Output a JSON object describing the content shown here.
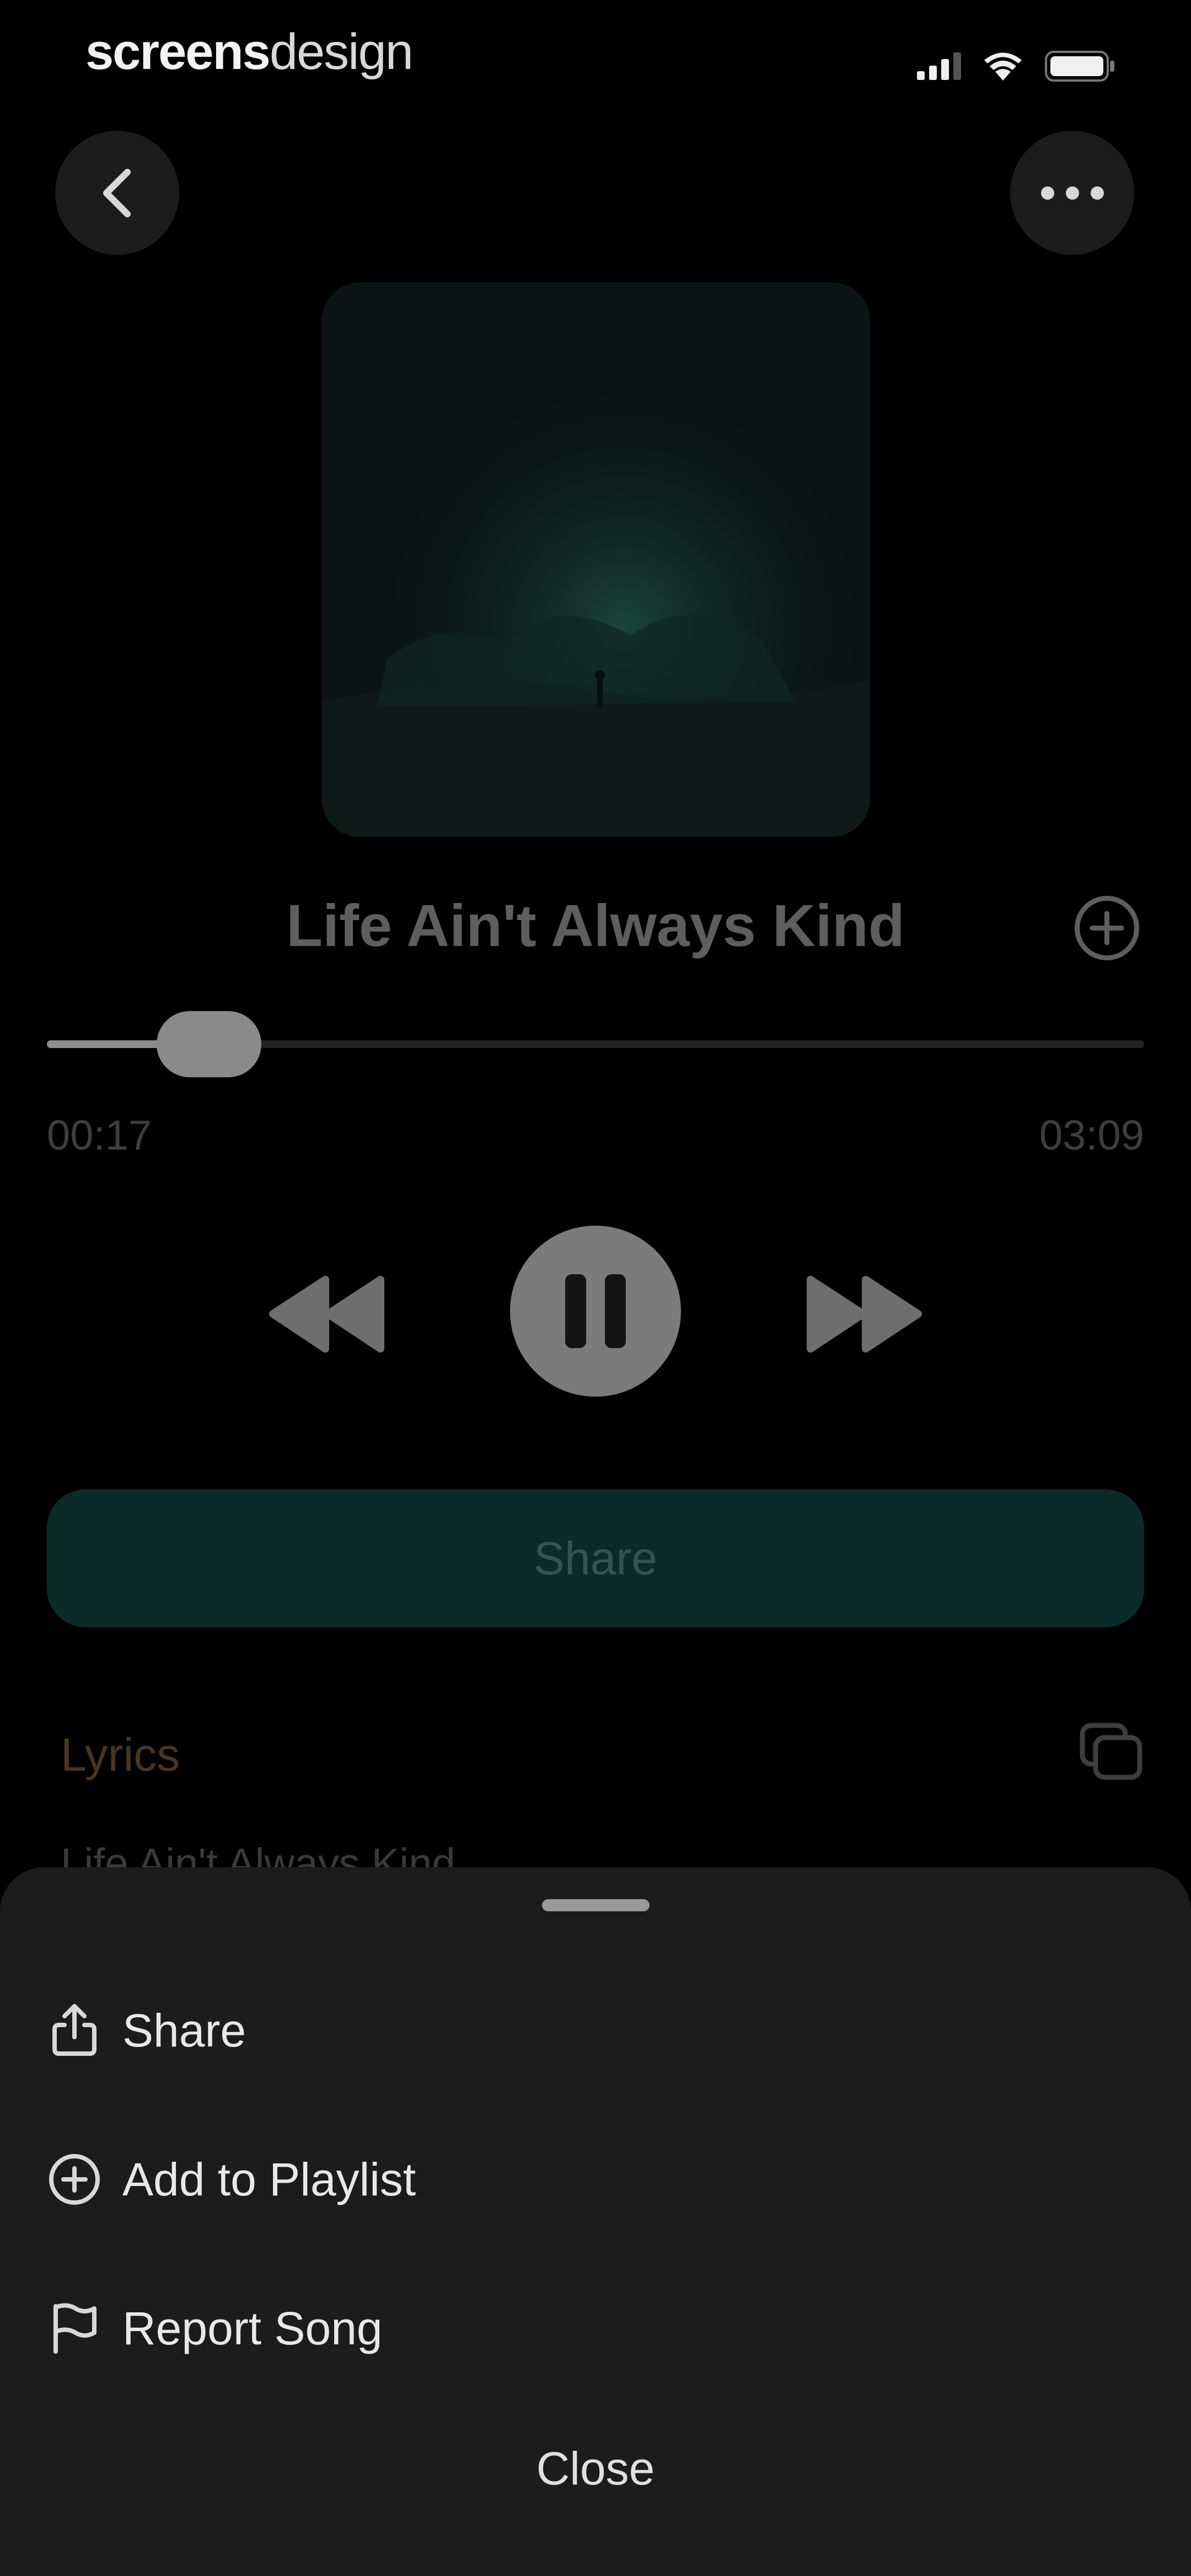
{
  "status_bar": {
    "brand_bold": "screens",
    "brand_light": "design",
    "signal_icon": "signal-icon",
    "wifi_icon": "wifi-icon",
    "battery_icon": "battery-icon"
  },
  "player": {
    "back_icon": "chevron-left-icon",
    "more_icon": "more-horizontal-icon",
    "song_title": "Life Ain't Always Kind",
    "add_icon": "plus-circle-icon",
    "progress_fraction": 0.11,
    "time_elapsed": "00:17",
    "time_total": "03:09",
    "rewind_icon": "rewind-icon",
    "pause_icon": "pause-icon",
    "forward_icon": "fast-forward-icon",
    "share_label": "Share",
    "lyrics_label": "Lyrics",
    "copy_icon": "copy-icon",
    "lyrics_first_line": "Life Ain't Always Kind"
  },
  "sheet": {
    "items": [
      {
        "label": "Share",
        "icon": "share-icon"
      },
      {
        "label": "Add to Playlist",
        "icon": "plus-circle-icon"
      },
      {
        "label": "Report Song",
        "icon": "flag-icon"
      }
    ],
    "close_label": "Close"
  },
  "colors": {
    "background": "#000000",
    "share_button": "#0b2b29",
    "sheet": "#1c1c1c",
    "lyrics_accent": "#4a3620"
  }
}
